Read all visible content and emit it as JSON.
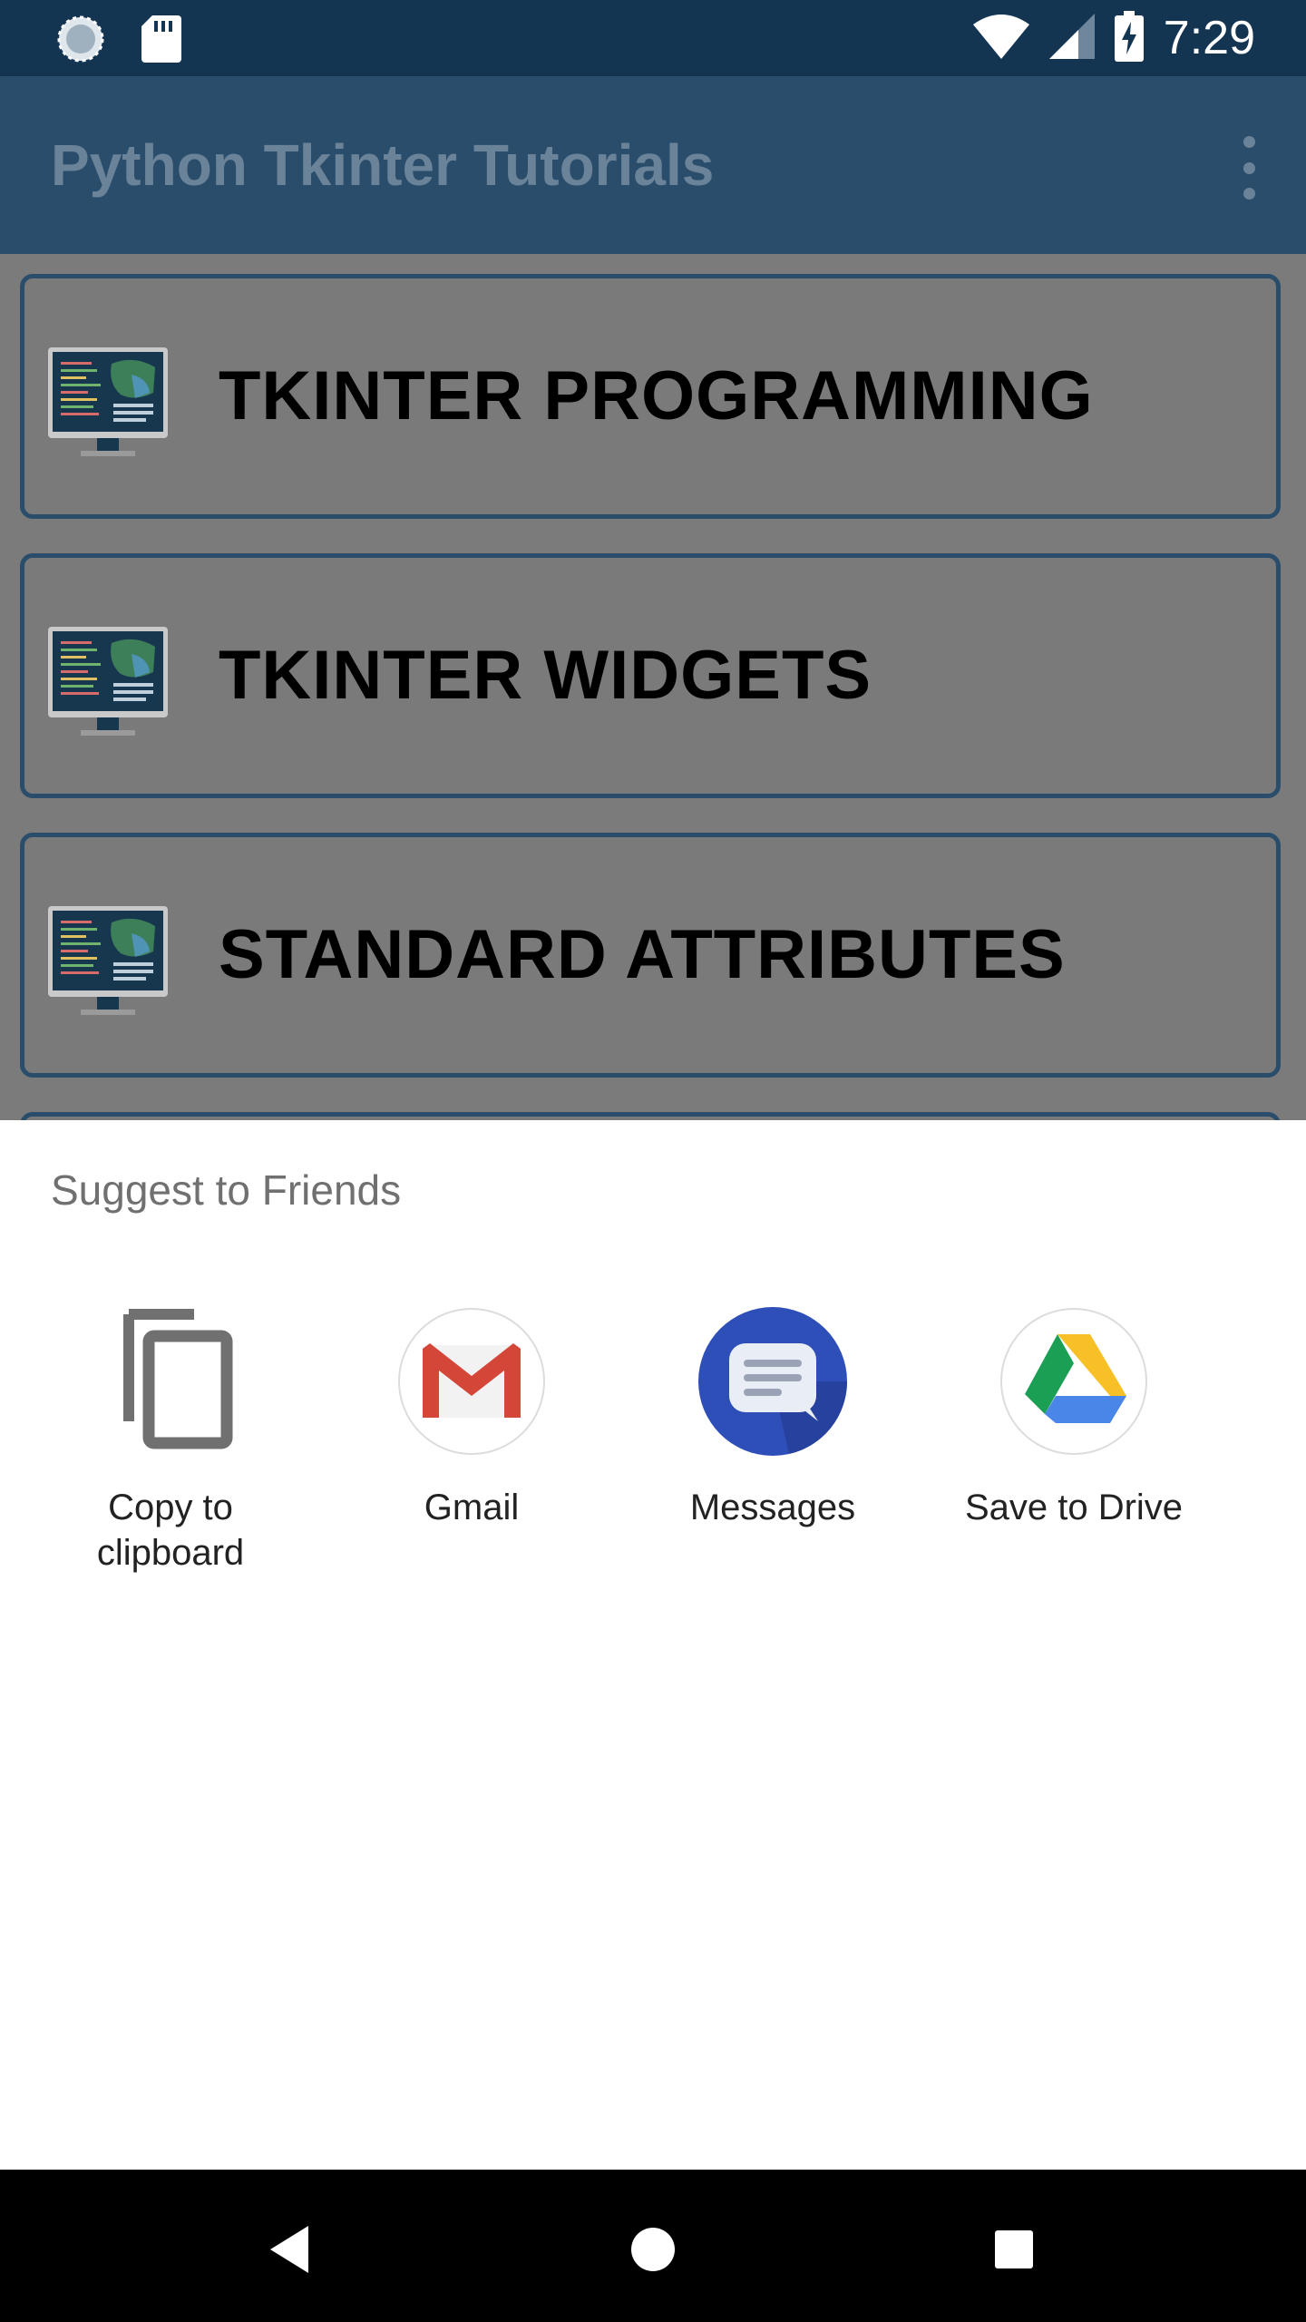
{
  "status_bar": {
    "time": "7:29",
    "icons": [
      "sync-icon",
      "sd-card-icon",
      "wifi-icon",
      "cell-signal-icon",
      "battery-charging-icon"
    ]
  },
  "app_bar": {
    "title": "Python Tkinter Tutorials",
    "overflow_icon": "more-vert-icon"
  },
  "list": {
    "items": [
      {
        "label": "TKINTER PROGRAMMING",
        "icon": "monitor-code-icon"
      },
      {
        "label": "TKINTER WIDGETS",
        "icon": "monitor-code-icon"
      },
      {
        "label": "STANDARD ATTRIBUTES",
        "icon": "monitor-code-icon"
      }
    ]
  },
  "share_sheet": {
    "title": "Suggest to Friends",
    "targets": [
      {
        "label": "Copy to\nclipboard",
        "icon": "copy-icon"
      },
      {
        "label": "Gmail",
        "icon": "gmail-icon"
      },
      {
        "label": "Messages",
        "icon": "messages-icon"
      },
      {
        "label": "Save to Drive",
        "icon": "drive-icon"
      }
    ]
  },
  "nav_bar": {
    "buttons": [
      "back-icon",
      "home-icon",
      "recents-icon"
    ]
  },
  "colors": {
    "status_bar": "#143552",
    "app_bar": "#2a4d6c",
    "scrim_overlay": "#7a7a7a",
    "messages_blue": "#2f4fb8",
    "gmail_red": "#d44638"
  }
}
